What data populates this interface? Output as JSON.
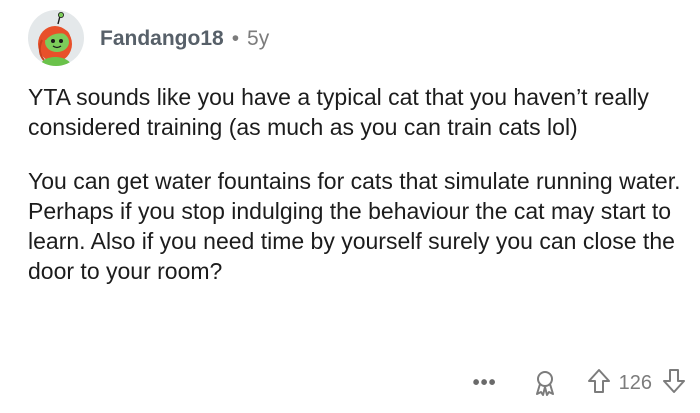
{
  "comment": {
    "username": "Fandango18",
    "separator": "•",
    "age": "5y",
    "paragraphs": [
      "YTA sounds like you have a typical cat that you haven’t really considered training (as much as you can train cats lol)",
      "You can get water fountains for cats that simulate running water. Perhaps if you stop indulging the behaviour the cat may start to learn. Also if you need time by yourself surely you can close the door to your room?"
    ],
    "actions": {
      "more_label": "•••",
      "vote_count": "126"
    }
  },
  "icons": {
    "avatar": "snoo-avatar",
    "more": "more-options-icon",
    "award": "award-icon",
    "upvote": "upvote-arrow-icon",
    "downvote": "downvote-arrow-icon"
  },
  "colors": {
    "text": "#1c1c1c",
    "meta": "#7c7c7c",
    "avatar_bg": "#e4e8ea",
    "avatar_hair": "#e8502a",
    "avatar_face": "#7ccc5a"
  }
}
